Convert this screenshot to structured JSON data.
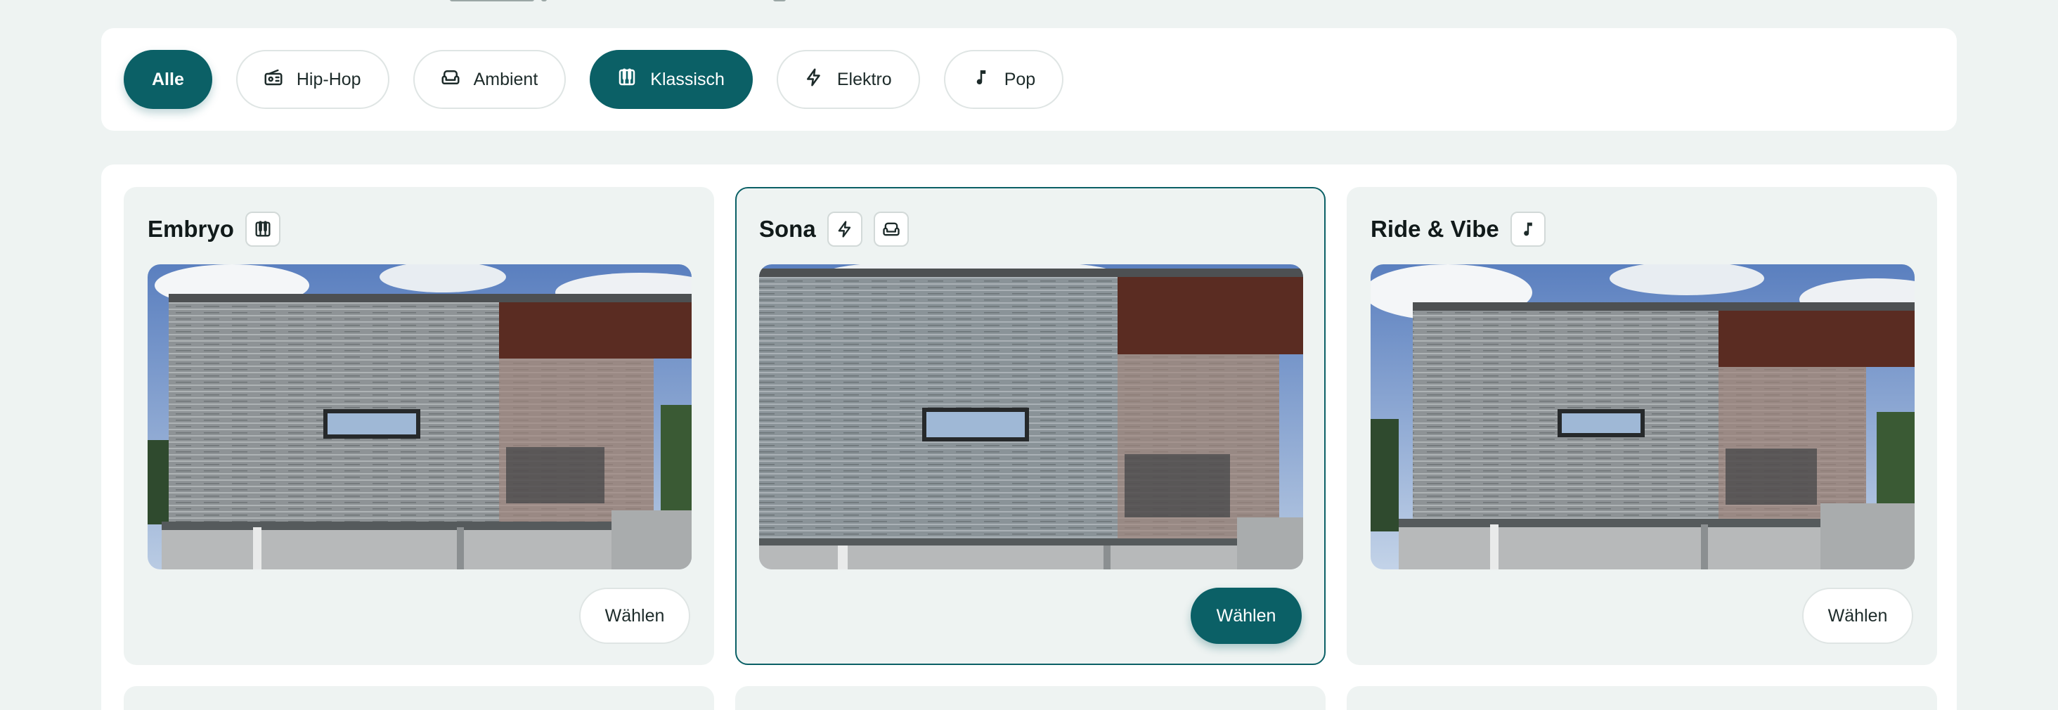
{
  "filters": [
    {
      "label": "Alle",
      "icon": "",
      "active": true
    },
    {
      "label": "Hip-Hop",
      "icon": "radio-icon",
      "active": false
    },
    {
      "label": "Ambient",
      "icon": "sofa-icon",
      "active": false
    },
    {
      "label": "Klassisch",
      "icon": "piano-icon",
      "active": true
    },
    {
      "label": "Elektro",
      "icon": "lightning-icon",
      "active": false
    },
    {
      "label": "Pop",
      "icon": "music-note-icon",
      "active": false
    }
  ],
  "cards": [
    {
      "title": "Embryo",
      "tags": [
        "piano-icon"
      ],
      "button_label": "Wählen",
      "selected": false
    },
    {
      "title": "Sona",
      "tags": [
        "lightning-icon",
        "sofa-icon"
      ],
      "button_label": "Wählen",
      "selected": true
    },
    {
      "title": "Ride & Vibe",
      "tags": [
        "music-note-icon"
      ],
      "button_label": "Wählen",
      "selected": false
    }
  ],
  "colors": {
    "accent": "#0b6066",
    "background": "#eef3f2",
    "card": "#eef3f2",
    "surface": "#ffffff"
  }
}
